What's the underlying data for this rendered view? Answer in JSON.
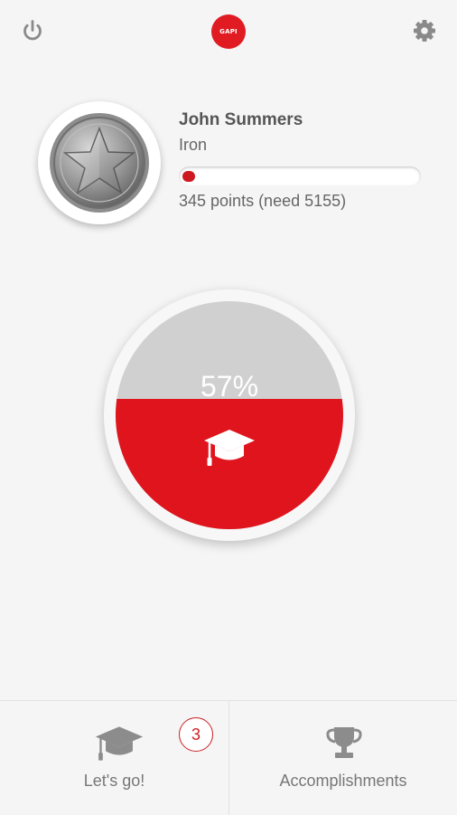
{
  "header": {
    "power_icon": "power-icon",
    "logo_text": "GAPI",
    "settings_icon": "gear-icon"
  },
  "profile": {
    "name": "John Summers",
    "level": "Iron",
    "points_text": "345 points (need 5155)",
    "progress_fraction": 0.063,
    "badge_icon": "star-medal-icon"
  },
  "gauge": {
    "percent_label": "57%",
    "fill_fraction": 0.57,
    "icon": "graduation-cap-icon"
  },
  "bottom_nav": {
    "lets_go_label": "Let's go!",
    "lets_go_icon": "graduation-cap-icon",
    "lets_go_count": "3",
    "accomplishments_label": "Accomplishments",
    "accomplishments_icon": "trophy-icon"
  },
  "colors": {
    "accent_red": "#df141d",
    "background": "#f5f5f5",
    "gauge_gray": "#d0d0d0"
  }
}
